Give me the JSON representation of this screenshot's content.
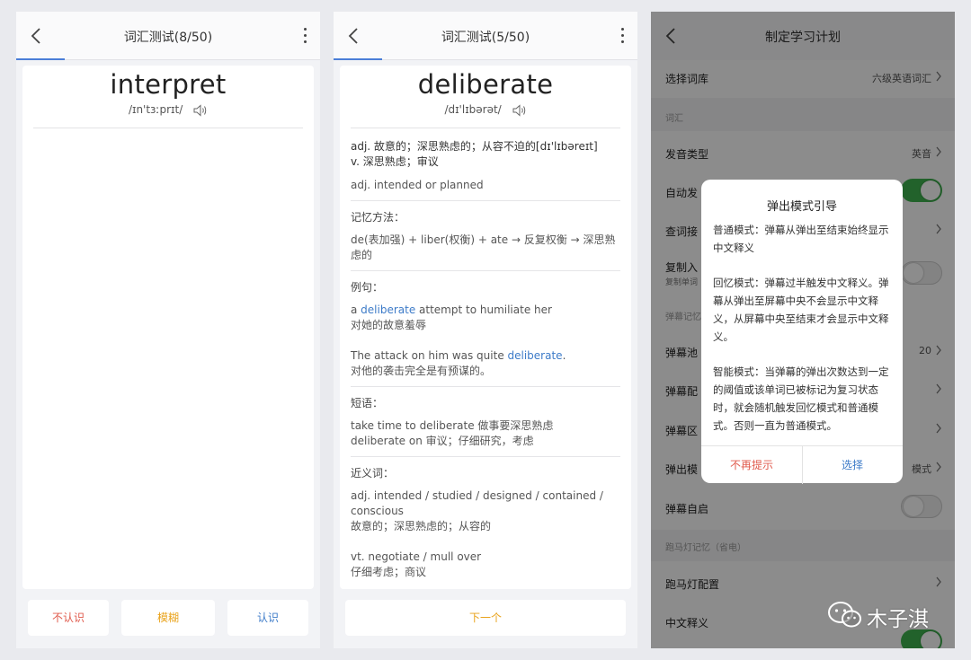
{
  "screen1": {
    "title": "词汇测试(8/50)",
    "word": "interpret",
    "phonetic": "/ɪn'tɜːprɪt/",
    "buttons": {
      "unknown": "不认识",
      "vague": "模糊",
      "known": "认识"
    },
    "colors": {
      "unknown": "#e05a4c",
      "vague": "#e9a21a",
      "known": "#3d7bc8"
    }
  },
  "screen2": {
    "title": "词汇测试(5/50)",
    "word": "deliberate",
    "phonetic": "/dɪ'lɪbərət/",
    "definition_line1": "adj. 故意的；深思熟虑的；从容不迫的[dɪ'lɪbəreɪt]",
    "definition_line2": "v. 深思熟虑；审议",
    "english_def": "adj. intended or planned",
    "memory_title": "记忆方法：",
    "memory_text": "de(表加强) + liber(权衡) + ate → 反复权衡 → 深思熟虑的",
    "examples_title": "例句：",
    "ex1_pre": "a ",
    "ex1_hl": "deliberate",
    "ex1_post": " attempt to humiliate her",
    "ex1_cn": "对她的故意羞辱",
    "ex2_pre": "The attack on him was quite ",
    "ex2_hl": "deliberate",
    "ex2_post": ".",
    "ex2_cn": "对他的袭击完全是有预谋的。",
    "phrases_title": "短语：",
    "phrase1": "take time to deliberate 做事要深思熟虑",
    "phrase2": "deliberate on 审议；仔细研究，考虑",
    "synonyms_title": "近义词：",
    "syn1": "adj. intended / studied / designed / contained / conscious",
    "syn1_cn": "故意的；深思熟虑的；从容的",
    "syn2": "vt. negotiate / mull over",
    "syn2_cn": "仔细考虑；商议",
    "next_button": "下一个"
  },
  "screen3": {
    "title": "制定学习计划",
    "rows": {
      "library_label": "选择词库",
      "library_value": "六级英语词汇",
      "vocab_header": "词汇",
      "pronunciation_label": "发音类型",
      "pronunciation_value": "英音",
      "autoplay_label": "自动发",
      "lookup_label": "查词接",
      "copy_label": "复制入",
      "copy_sub": "复制单词",
      "danmaku_header": "弹幕记忆",
      "pool_label": "弹幕池",
      "pool_value": "20",
      "config_label": "弹幕配",
      "area_label": "弹幕区",
      "mode_label": "弹出模",
      "mode_value": "模式",
      "auto_start_label": "弹幕自启",
      "marquee_header": "跑马灯记忆（省电）",
      "marquee_label": "跑马灯配置",
      "chinese_label": "中文释义"
    },
    "dialog": {
      "title": "弹出模式引导",
      "p1": "普通模式：弹幕从弹出至结束始终显示中文释义",
      "p2": "回忆模式：弹幕过半触发中文释义。弹幕从弹出至屏幕中央不会显示中文释义，从屏幕中央至结束才会显示中文释义。",
      "p3": "智能模式：当弹幕的弹出次数达到一定的阈值或该单词已被标记为复习状态时，就会随机触发回忆模式和普通模式。否则一直为普通模式。",
      "cancel": "不再提示",
      "confirm": "选择"
    },
    "colors": {
      "toggle_on": "#3fb34f",
      "cancel": "#e05a4c",
      "confirm": "#3d7bc8"
    }
  },
  "watermark": {
    "text": "木子淇",
    "icon": "wechat-icon"
  }
}
